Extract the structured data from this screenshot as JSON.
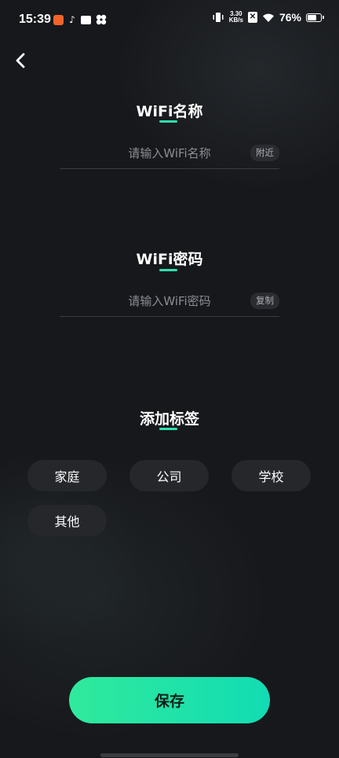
{
  "status_bar": {
    "time": "15:39",
    "net_speed_value": "3.30",
    "net_speed_unit": "KB/s",
    "x_badge": "✕",
    "battery_percent": "76%",
    "battery_level": 0.76,
    "tiktok_glyph": "♪",
    "app_icons": [
      "orange-app-icon",
      "tiktok-icon",
      "message-app-icon",
      "flower-app-icon"
    ],
    "right_icons": [
      "vibrate-icon",
      "net-speed",
      "x-app-icon",
      "wifi-icon",
      "battery-icon"
    ]
  },
  "header": {
    "back_icon": "chevron-left-icon"
  },
  "wifi_name": {
    "title": "WiFi名称",
    "placeholder": "请输入WiFi名称",
    "value": "",
    "action_label": "附近"
  },
  "wifi_password": {
    "title": "WiFi密码",
    "placeholder": "请输入WiFi密码",
    "value": "",
    "action_label": "复制"
  },
  "tags": {
    "title": "添加标签",
    "items": [
      "家庭",
      "公司",
      "学校",
      "其他"
    ]
  },
  "save_label": "保存",
  "colors": {
    "background": "#17181c",
    "accent": "#2fe0ad",
    "button_gradient_start": "#30ea9c",
    "button_gradient_end": "#12dcb4",
    "chip_background": "#25272b"
  }
}
